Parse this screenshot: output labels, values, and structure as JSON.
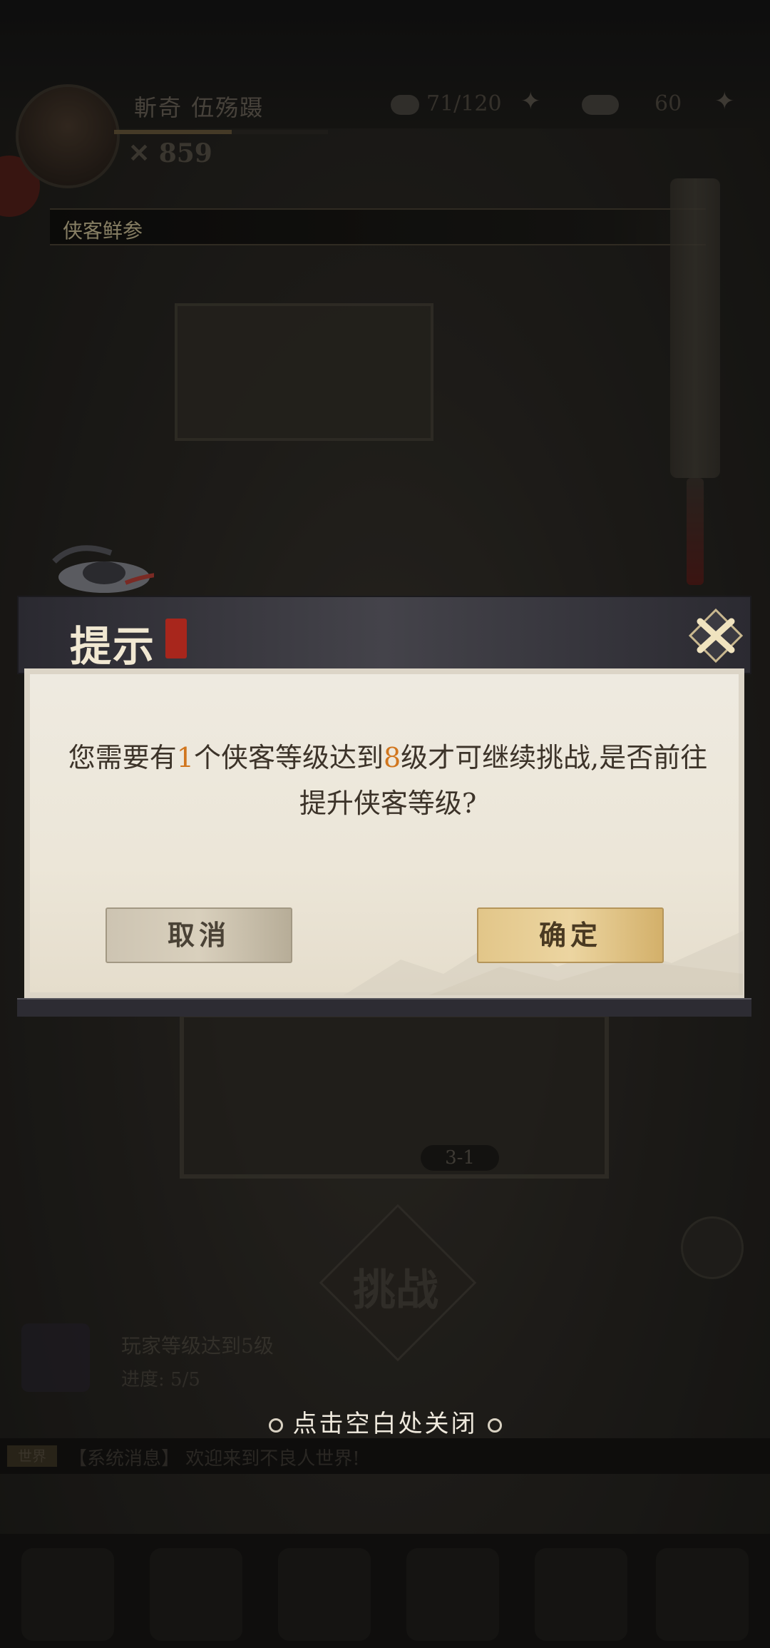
{
  "background": {
    "player": {
      "name": "斬奇 伍殇蹑",
      "power": "859",
      "exp_progress": 0.55
    },
    "stats": {
      "stamina": "71/120",
      "currency": "60"
    },
    "news_ticker": "侠客鲜参",
    "stage_number": "3-1",
    "challenge_label": "挑战",
    "task": {
      "title": "玩家等级达到5级",
      "progress": "进度: 5/5"
    },
    "chat": {
      "channel": "世界",
      "message": "【系统消息】 欢迎来到不良人世界!"
    }
  },
  "dialog": {
    "title": "提示",
    "message_prefix": "您需要有",
    "count": "1",
    "message_mid": "个侠客等级达到",
    "level": "8",
    "message_suffix": "级才可继续挑战,是否前往提升侠客等级?",
    "cancel_label": "取消",
    "confirm_label": "确定"
  },
  "tap_to_close": "点击空白处关闭",
  "colors": {
    "highlight": "#d1761e",
    "confirm_button": "#e6cc92",
    "cancel_button": "#d2c9b6"
  }
}
